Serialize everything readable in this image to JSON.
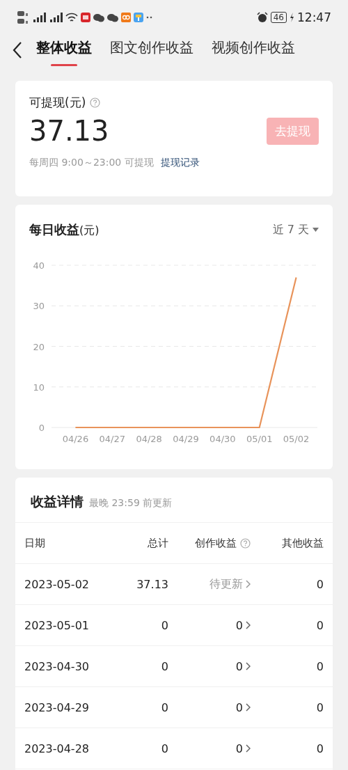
{
  "status_bar": {
    "battery": "46",
    "time": "12:47"
  },
  "tabs": [
    {
      "label": "整体收益",
      "selected": true
    },
    {
      "label": "图文创作收益",
      "selected": false
    },
    {
      "label": "视频创作收益",
      "selected": false
    }
  ],
  "balance": {
    "label": "可提现(元)",
    "amount": "37.13",
    "button": {
      "label": "去提现",
      "disabled": true
    },
    "note": "每周四 9:00～23:00 可提现",
    "link": "提现记录"
  },
  "daily": {
    "title": "每日收益",
    "unit": "(元)",
    "range": "近 7 天",
    "chart_data": {
      "type": "line",
      "grid": true,
      "categories": [
        "04/26",
        "04/27",
        "04/28",
        "04/29",
        "04/30",
        "05/01",
        "05/02"
      ],
      "yticks": [
        0,
        10,
        20,
        30,
        40
      ],
      "ylim": [
        0,
        40
      ],
      "series": [
        {
          "color": "#e8935a",
          "values": [
            0,
            0,
            0,
            0,
            0,
            0,
            37
          ]
        }
      ]
    }
  },
  "details": {
    "title": "收益详情",
    "subtitle": "最晚 23:59 前更新",
    "columns": [
      "日期",
      "总计",
      "创作收益",
      "其他收益"
    ],
    "rows": [
      {
        "date": "2023-05-02",
        "total": "37.13",
        "creation": "待更新",
        "pending": true,
        "other": "0"
      },
      {
        "date": "2023-05-01",
        "total": "0",
        "creation": "0",
        "pending": false,
        "other": "0"
      },
      {
        "date": "2023-04-30",
        "total": "0",
        "creation": "0",
        "pending": false,
        "other": "0"
      },
      {
        "date": "2023-04-29",
        "total": "0",
        "creation": "0",
        "pending": false,
        "other": "0"
      },
      {
        "date": "2023-04-28",
        "total": "0",
        "creation": "0",
        "pending": false,
        "other": "0"
      }
    ]
  }
}
